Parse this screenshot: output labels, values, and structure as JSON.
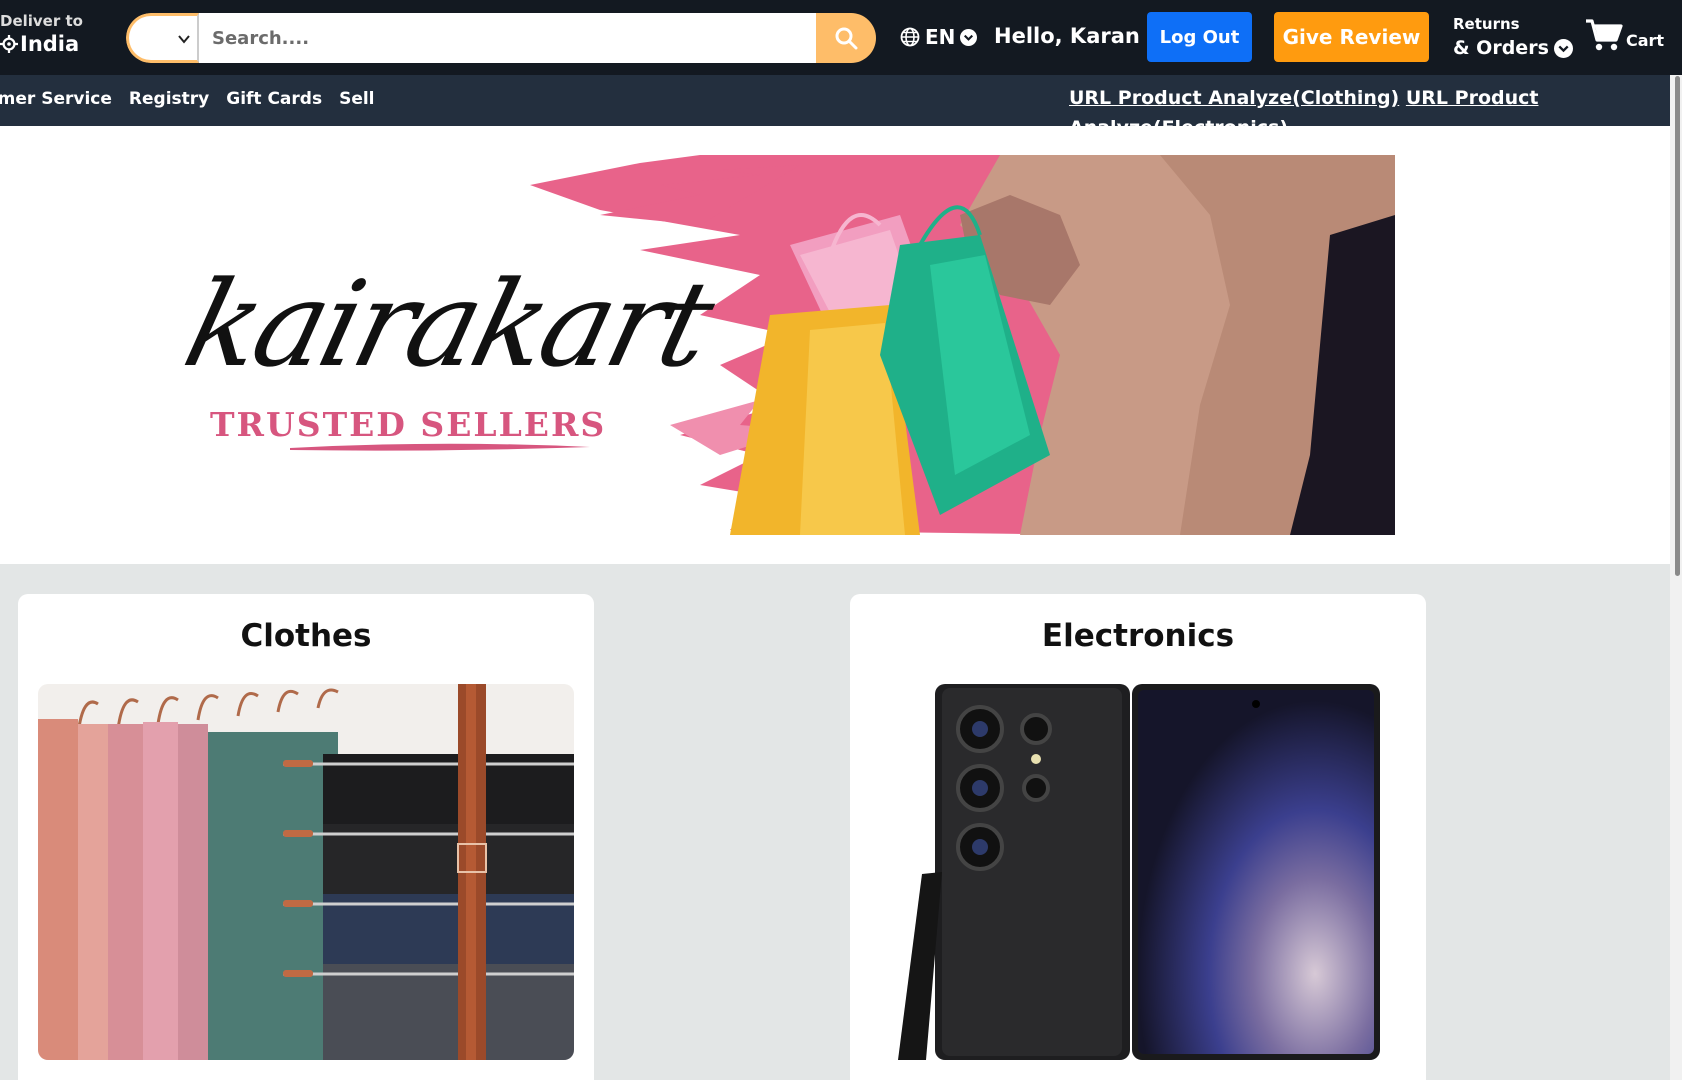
{
  "header": {
    "deliver_label": "Deliver to",
    "deliver_location": "India",
    "search_placeholder": "Search....",
    "search_category": "",
    "language": "EN",
    "greeting": "Hello, Karan",
    "logout_label": "Log Out",
    "review_label": "Give Review",
    "returns_label": "Returns",
    "orders_label": "& Orders",
    "cart_label": "Cart"
  },
  "subnav": {
    "items": [
      "omer Service",
      "Registry",
      "Gift Cards",
      "Sell"
    ],
    "link_clothing": "URL Product Analyze(Clothing)",
    "link_electronics": "URL Product Analyze(Electronics)"
  },
  "banner": {
    "brand": "kairakart",
    "tagline": "TRUSTED  SELLERS"
  },
  "categories": [
    {
      "title": "Clothes"
    },
    {
      "title": "Electronics"
    }
  ],
  "colors": {
    "topbar": "#131921",
    "subnav": "#232f3e",
    "accent_orange": "#febd69",
    "logout_blue": "#0e6ff7",
    "review_orange": "#ff9b0f",
    "brand_pink": "#d7567f"
  }
}
